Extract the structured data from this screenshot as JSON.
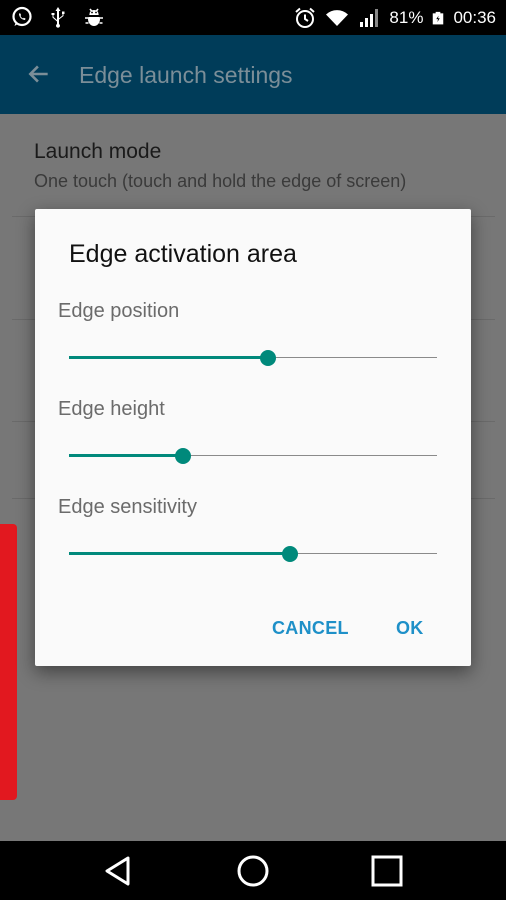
{
  "status_bar": {
    "battery": "81%",
    "time": "00:36",
    "left_icons": [
      "whatsapp-icon",
      "usb-icon",
      "android-debug-icon"
    ],
    "right_icons": [
      "alarm-icon",
      "wifi-icon",
      "signal-icon",
      "battery-icon"
    ]
  },
  "app_bar": {
    "title": "Edge launch settings",
    "back_icon": "arrow-back-icon"
  },
  "list": {
    "launch_mode_title": "Launch mode",
    "launch_mode_sub": "One touch (touch and hold the edge of screen)"
  },
  "dialog": {
    "title": "Edge activation area",
    "sliders": [
      {
        "label": "Edge position",
        "value": 0.54
      },
      {
        "label": "Edge height",
        "value": 0.31
      },
      {
        "label": "Edge sensitivity",
        "value": 0.6
      }
    ],
    "cancel_label": "CANCEL",
    "ok_label": "OK"
  },
  "colors": {
    "accent": "#00897b",
    "button_text": "#1e90c8",
    "edge_handle": "#e2181f"
  },
  "nav_bar": {
    "icons": [
      "back-triangle-icon",
      "home-circle-icon",
      "recents-square-icon"
    ]
  }
}
